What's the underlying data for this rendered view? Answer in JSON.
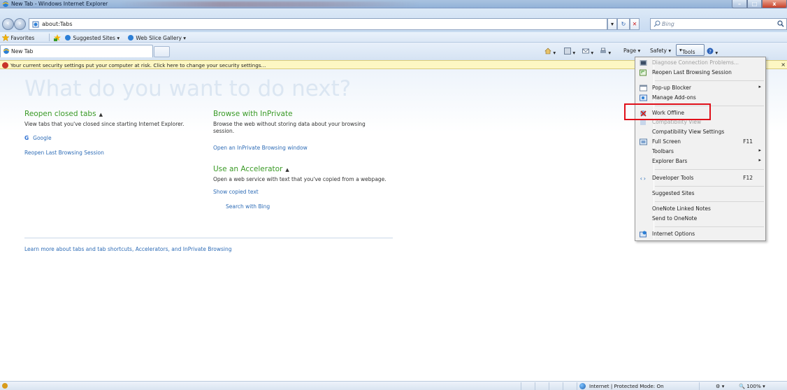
{
  "window": {
    "title": "New Tab - Windows Internet Explorer",
    "min": "–",
    "max": "□",
    "close": "x"
  },
  "address_bar": {
    "url": "about:Tabs",
    "search_placeholder": "Bing",
    "dropdown": "▾",
    "refresh": "↻",
    "stop": "✕"
  },
  "favorites_bar": {
    "favorites": "Favorites",
    "suggested_sites": "Suggested Sites",
    "web_slice_gallery": "Web Slice Gallery"
  },
  "tabs": [
    {
      "label": "New Tab"
    }
  ],
  "command_bar": {
    "page": "Page",
    "safety": "Safety",
    "tools": "Tools"
  },
  "info_bar": {
    "text": "Your current security settings put your computer at risk. Click here to change your security settings...",
    "close": "×"
  },
  "content": {
    "heading": "What do you want to do next?",
    "reopen": {
      "title": "Reopen closed tabs",
      "desc": "View tabs that you've closed since starting Internet Explorer.",
      "items": [
        "Google"
      ],
      "link": "Reopen Last Browsing Session"
    },
    "inprivate": {
      "title": "Browse with InPrivate",
      "desc": "Browse the web without storing data about your browsing session.",
      "link": "Open an InPrivate Browsing window"
    },
    "accelerator": {
      "title": "Use an Accelerator",
      "desc": "Open a web service with text that you've copied from a webpage.",
      "link": "Show copied text",
      "sublink": "Search with Bing"
    },
    "footer_link": "Learn more about tabs and tab shortcuts, Accelerators, and InPrivate Browsing"
  },
  "tools_menu": {
    "items": [
      {
        "label": "Diagnose Connection Problems...",
        "disabled": true,
        "icon": "diagnose-icon"
      },
      {
        "label": "Reopen Last Browsing Session",
        "icon": "reopen-icon"
      },
      {
        "label": "Pop-up Blocker",
        "submenu": true,
        "icon": "popup-icon"
      },
      {
        "label": "Manage Add-ons",
        "icon": "addons-icon"
      },
      {
        "label": "Work Offline",
        "icon": "work-offline-icon"
      },
      {
        "label": "Compatibility View",
        "disabled": true,
        "icon": "compat-icon"
      },
      {
        "label": "Compatibility View Settings"
      },
      {
        "label": "Full Screen",
        "shortcut": "F11",
        "icon": "fullscreen-icon"
      },
      {
        "label": "Toolbars",
        "submenu": true
      },
      {
        "label": "Explorer Bars",
        "submenu": true
      },
      {
        "label": "Developer Tools",
        "shortcut": "F12",
        "icon": "devtools-icon"
      },
      {
        "label": "Suggested Sites"
      },
      {
        "label": "OneNote Linked Notes"
      },
      {
        "label": "Send to OneNote"
      },
      {
        "label": "Internet Options",
        "icon": "options-icon"
      }
    ],
    "submenu_arrow": "▸"
  },
  "status_bar": {
    "zone": "Internet | Protected Mode: On",
    "zoom": "100%"
  },
  "colors": {
    "accent_green": "#3a9a26",
    "link_blue": "#2e6cb6",
    "highlight_red": "#e0101a",
    "infobar_yellow": "#fdf7c3"
  }
}
